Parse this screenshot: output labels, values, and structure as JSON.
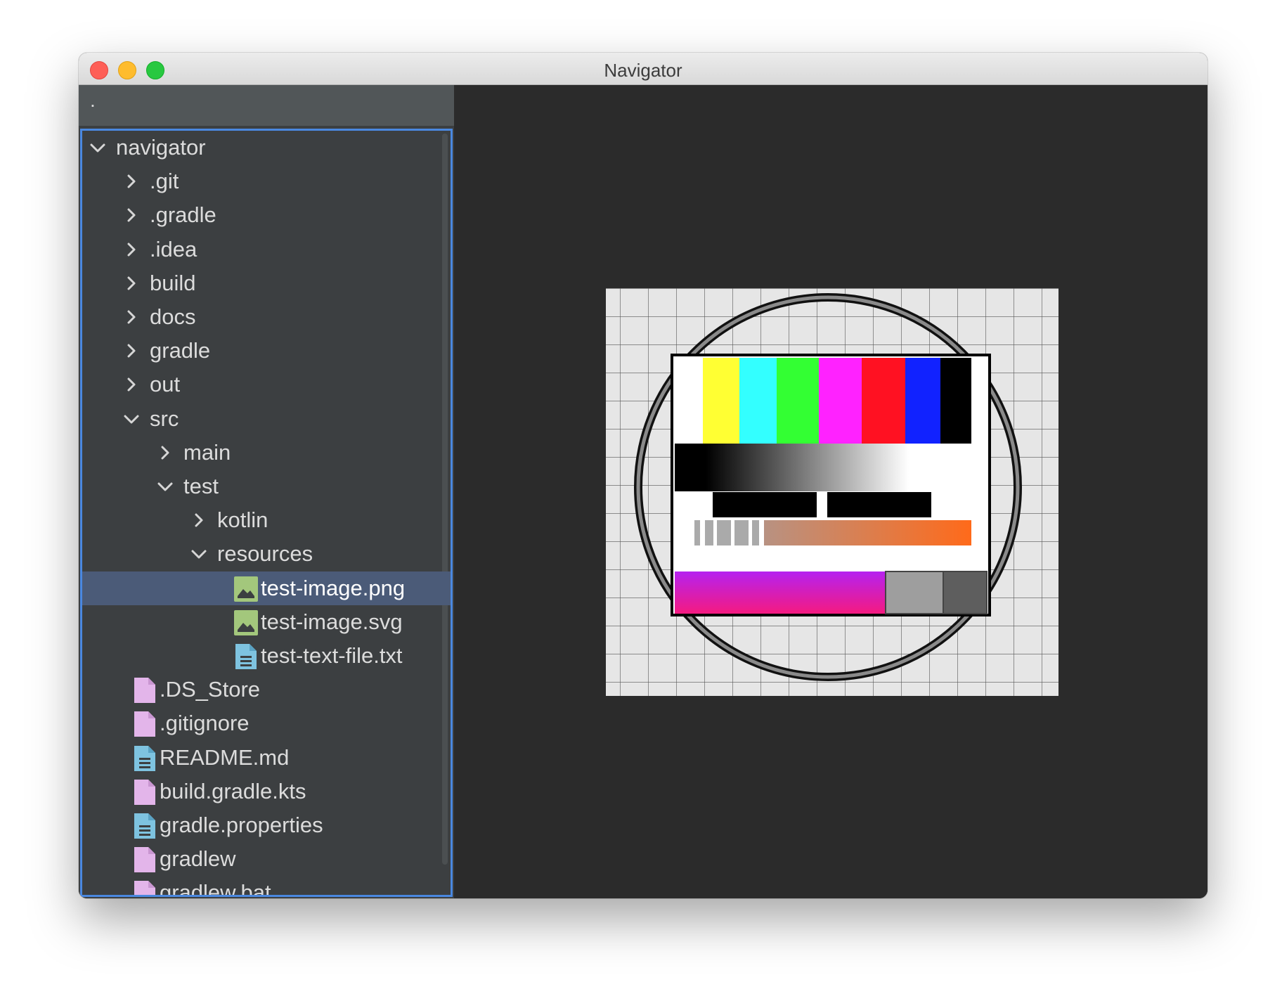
{
  "window": {
    "title": "Navigator"
  },
  "pathbar": {
    "text": "."
  },
  "tree": [
    {
      "label": "navigator",
      "type": "folder",
      "expanded": true,
      "depth": 0
    },
    {
      "label": ".git",
      "type": "folder",
      "expanded": false,
      "depth": 1
    },
    {
      "label": ".gradle",
      "type": "folder",
      "expanded": false,
      "depth": 1
    },
    {
      "label": ".idea",
      "type": "folder",
      "expanded": false,
      "depth": 1
    },
    {
      "label": "build",
      "type": "folder",
      "expanded": false,
      "depth": 1
    },
    {
      "label": "docs",
      "type": "folder",
      "expanded": false,
      "depth": 1
    },
    {
      "label": "gradle",
      "type": "folder",
      "expanded": false,
      "depth": 1
    },
    {
      "label": "out",
      "type": "folder",
      "expanded": false,
      "depth": 1
    },
    {
      "label": "src",
      "type": "folder",
      "expanded": true,
      "depth": 1
    },
    {
      "label": "main",
      "type": "folder",
      "expanded": false,
      "depth": 2
    },
    {
      "label": "test",
      "type": "folder",
      "expanded": true,
      "depth": 2
    },
    {
      "label": "kotlin",
      "type": "folder",
      "expanded": false,
      "depth": 3
    },
    {
      "label": "resources",
      "type": "folder",
      "expanded": true,
      "depth": 3
    },
    {
      "label": "test-image.png",
      "type": "image",
      "depth": 4,
      "selected": true
    },
    {
      "label": "test-image.svg",
      "type": "image",
      "depth": 4
    },
    {
      "label": "test-text-file.txt",
      "type": "text",
      "depth": 4
    },
    {
      "label": ".DS_Store",
      "type": "file",
      "depth": 1
    },
    {
      "label": ".gitignore",
      "type": "file",
      "depth": 1
    },
    {
      "label": "README.md",
      "type": "text",
      "depth": 1
    },
    {
      "label": "build.gradle.kts",
      "type": "file",
      "depth": 1
    },
    {
      "label": "gradle.properties",
      "type": "text",
      "depth": 1
    },
    {
      "label": "gradlew",
      "type": "file",
      "depth": 1
    },
    {
      "label": "gradlew.bat",
      "type": "file",
      "depth": 1
    }
  ],
  "icons": {
    "folder_collapsed": "chevron-right-icon",
    "folder_expanded": "chevron-down-icon",
    "image": "image-file-icon",
    "text": "text-file-icon",
    "file": "file-icon"
  },
  "colors": {
    "selection": "#4b5b78",
    "focus_border": "#4a88e0",
    "image_icon": "#a3c77c",
    "text_icon": "#7ec3e0",
    "file_icon": "#e3b5ea"
  }
}
